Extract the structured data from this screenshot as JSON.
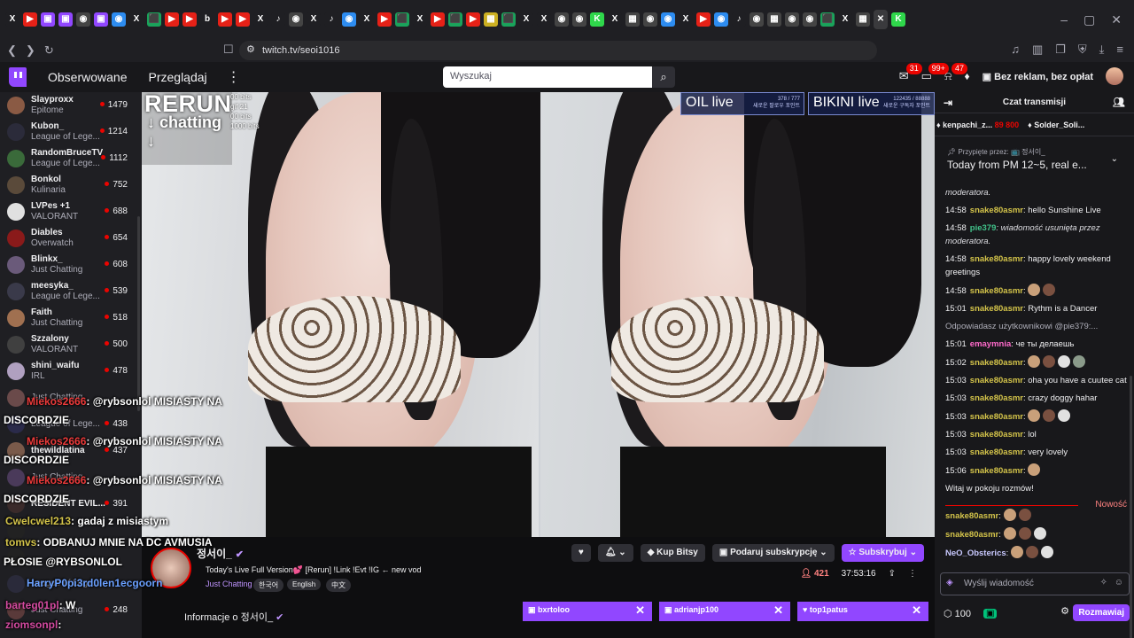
{
  "browser": {
    "url": "twitch.tv/seoi1016",
    "tab_favicons": [
      {
        "glyph": "X",
        "color": "#1f1f23"
      },
      {
        "glyph": "▶",
        "color": "#e62117"
      },
      {
        "glyph": "▣",
        "color": "#9147ff"
      },
      {
        "glyph": "▣",
        "color": "#9147ff"
      },
      {
        "glyph": "◉",
        "color": "#444"
      },
      {
        "glyph": "▣",
        "color": "#9147ff"
      },
      {
        "glyph": "◉",
        "color": "#2d8cf0"
      },
      {
        "glyph": "X",
        "color": "#1f1f23"
      },
      {
        "glyph": "⬛",
        "color": "#1aa35b"
      },
      {
        "glyph": "▶",
        "color": "#e62117"
      },
      {
        "glyph": "▶",
        "color": "#e62117"
      },
      {
        "glyph": "b",
        "color": "#1f1f23"
      },
      {
        "glyph": "▶",
        "color": "#e62117"
      },
      {
        "glyph": "▶",
        "color": "#e62117"
      },
      {
        "glyph": "X",
        "color": "#1f1f23"
      },
      {
        "glyph": "♪",
        "color": "#1f1f23"
      },
      {
        "glyph": "◉",
        "color": "#444"
      },
      {
        "glyph": "X",
        "color": "#1f1f23"
      },
      {
        "glyph": "♪",
        "color": "#1f1f23"
      },
      {
        "glyph": "◉",
        "color": "#2d8cf0"
      },
      {
        "glyph": "X",
        "color": "#1f1f23"
      },
      {
        "glyph": "▶",
        "color": "#e62117"
      },
      {
        "glyph": "⬛",
        "color": "#1aa35b"
      },
      {
        "glyph": "X",
        "color": "#1f1f23"
      },
      {
        "glyph": "▶",
        "color": "#e62117"
      },
      {
        "glyph": "⬛",
        "color": "#1aa35b"
      },
      {
        "glyph": "▶",
        "color": "#e62117"
      },
      {
        "glyph": "▦",
        "color": "#ccb022"
      },
      {
        "glyph": "⬛",
        "color": "#1aa35b"
      },
      {
        "glyph": "X",
        "color": "#1f1f23"
      },
      {
        "glyph": "X",
        "color": "#1f1f23"
      },
      {
        "glyph": "◉",
        "color": "#444"
      },
      {
        "glyph": "◉",
        "color": "#444"
      },
      {
        "glyph": "K",
        "color": "#2fd74b"
      },
      {
        "glyph": "X",
        "color": "#1f1f23"
      },
      {
        "glyph": "▦",
        "color": "#444"
      },
      {
        "glyph": "◉",
        "color": "#444"
      },
      {
        "glyph": "◉",
        "color": "#2d8cf0"
      },
      {
        "glyph": "X",
        "color": "#1f1f23"
      },
      {
        "glyph": "▶",
        "color": "#e62117"
      },
      {
        "glyph": "◉",
        "color": "#2d8cf0"
      },
      {
        "glyph": "♪",
        "color": "#1f1f23"
      },
      {
        "glyph": "◉",
        "color": "#444"
      },
      {
        "glyph": "▦",
        "color": "#444"
      },
      {
        "glyph": "◉",
        "color": "#444"
      },
      {
        "glyph": "◉",
        "color": "#444"
      },
      {
        "glyph": "⬛",
        "color": "#1aa35b"
      },
      {
        "glyph": "X",
        "color": "#1f1f23"
      },
      {
        "glyph": "▦",
        "color": "#444"
      },
      {
        "glyph": "✕",
        "color": "#3a3a3d"
      },
      {
        "glyph": "K",
        "color": "#2fd74b"
      }
    ]
  },
  "topnav": {
    "following": "Obserwowane",
    "browse": "Przeglądaj",
    "search_placeholder": "Wyszukaj",
    "badge_1": "31",
    "badge_2": "99+",
    "badge_3": "47",
    "no_ads": "Bez reklam, bez opłat"
  },
  "sidebar": {
    "channels": [
      {
        "name": "Slayproxx",
        "category": "Epitome",
        "viewers": "1479",
        "avatar": "#8a5a44"
      },
      {
        "name": "Kubon_",
        "category": "League of Lege...",
        "viewers": "1214",
        "avatar": "#2b2b3a"
      },
      {
        "name": "RandomBruceTV",
        "category": "League of Lege...",
        "viewers": "1112",
        "avatar": "#3a6a3a"
      },
      {
        "name": "Bonkol",
        "category": "Kulinaria",
        "viewers": "752",
        "avatar": "#5a4a3a"
      },
      {
        "name": "LVPes +1",
        "category": "VALORANT",
        "viewers": "688",
        "avatar": "#e0e0e0"
      },
      {
        "name": "Diables",
        "category": "Overwatch",
        "viewers": "654",
        "avatar": "#8a1a1a"
      },
      {
        "name": "Blinkx_",
        "category": "Just Chatting",
        "viewers": "608",
        "avatar": "#6a5a7a"
      },
      {
        "name": "meesyka_",
        "category": "League of Lege...",
        "viewers": "539",
        "avatar": "#3a3a4a"
      },
      {
        "name": "Faith",
        "category": "Just Chatting",
        "viewers": "518",
        "avatar": "#a07050"
      },
      {
        "name": "Szzalony",
        "category": "VALORANT",
        "viewers": "500",
        "avatar": "#404040"
      },
      {
        "name": "shini_waifu",
        "category": "IRL",
        "viewers": "478",
        "avatar": "#b0a0c0"
      },
      {
        "name": "",
        "category": "Just Chatting",
        "viewers": "",
        "avatar": "#6a4a4a"
      },
      {
        "name": "",
        "category": "League of Lege...",
        "viewers": "438",
        "avatar": "#2a2a4a"
      },
      {
        "name": "thewildlatina",
        "category": "",
        "viewers": "437",
        "avatar": "#7a5a4a"
      },
      {
        "name": "",
        "category": "Just Chatting",
        "viewers": "",
        "avatar": "#4a3a5a"
      },
      {
        "name": "RESIDENT EVIL...",
        "category": "",
        "viewers": "391",
        "avatar": "#3a2a2a"
      },
      {
        "name": "",
        "category": "",
        "viewers": "",
        "avatar": "#222"
      },
      {
        "name": "",
        "category": "",
        "viewers": "",
        "avatar": "#222"
      },
      {
        "name": "",
        "category": "League of Lege...",
        "viewers": "",
        "avatar": "#2a2a3a"
      },
      {
        "name": "",
        "category": "Just Chatting",
        "viewers": "248",
        "avatar": "#5a3a3a"
      }
    ]
  },
  "video": {
    "rerun": "RERUN",
    "chatting": "↓ chatting ↓",
    "bits_lines": [
      "00 bits",
      "gif 21",
      "",
      "00 bits",
      "1000 bits"
    ],
    "oil_label": "OIL live",
    "oil_meta": [
      "378 / 777",
      "새로운 팔로우 포인트"
    ],
    "bikini_label": "BIKINI live",
    "bikini_meta": [
      "122435 / 88888",
      "새로운 구독자 포인트"
    ]
  },
  "overlay_chat": [
    {
      "user": "Miekos2666",
      "text": ": @rybsonlol MISIASTY NA",
      "user_color": "#eb3a3a"
    },
    {
      "user": "",
      "text": "DISCORDZIE",
      "user_color": "#ffffff"
    },
    {
      "user": "Miekos2666",
      "text": ": @rybsonlol MISIASTY NA",
      "user_color": "#eb3a3a"
    },
    {
      "user": "",
      "text": "DISCORDZIE",
      "user_color": "#ffffff"
    },
    {
      "user": "Miekos2666",
      "text": ": @rybsonlol MISIASTY NA",
      "user_color": "#eb3a3a"
    },
    {
      "user": "",
      "text": "DISCORDZIE",
      "user_color": "#ffffff"
    },
    {
      "user": "Cwelcwel213",
      "text": ": gadaj z misiastym",
      "user_color": "#d4c44a"
    },
    {
      "user": "tomvs",
      "text": ": ODBANUJ MNIE NA DC AVMUSIA",
      "user_color": "#d4c44a"
    },
    {
      "user": "",
      "text": "PŁOSIE @RYBSONLOL",
      "user_color": "#ffffff"
    },
    {
      "user": "HarryP0pi3rd0len1ecgoorn",
      "text": "",
      "user_color": "#6aa0ff"
    },
    {
      "user": "barteg01pl",
      "text": ": W",
      "user_color": "#d44aa0"
    },
    {
      "user": "ziomsonpl",
      "text": ": ",
      "user_color": "#d44aa0"
    }
  ],
  "stream": {
    "streamer": "정서이_",
    "title": "Today's Live Full Version💕 [Rerun] !Link !Evt !IG ← new vod",
    "category": "Just Chatting",
    "tags": [
      "한국어",
      "English",
      "中文"
    ],
    "follow_icon": "heart-icon",
    "bits_button": "Kup Bitsy",
    "gift_button": "Podaruj subskrypcję",
    "subscribe_button": "Subskrybuj",
    "viewers": "421",
    "uptime": "37:53:16",
    "about": "Informacje o 정서이_",
    "accent": "#9147ff"
  },
  "popup_tabs": [
    "bxrtoloo",
    "adrianjp100",
    "top1patus"
  ],
  "chat": {
    "header": "Czat transmisji",
    "gifters": [
      {
        "name": "kenpachi_z...",
        "amount": "89 800"
      },
      {
        "name": "Solder_Soli...",
        "amount": ""
      }
    ],
    "pinned_by": "Przypięte przez: 📺 정서이_",
    "pinned_text": "Today from PM 12~5, real e...",
    "messages": [
      {
        "time": "",
        "user": "",
        "user_color": "#efeff1",
        "text": "moderatora.",
        "deleted": true
      },
      {
        "time": "14:58",
        "user": "snake80asmr",
        "user_color": "#d4c44a",
        "text": ": hello Sunshine Live",
        "deleted": false
      },
      {
        "time": "14:58",
        "user": "pie379",
        "user_color": "#41c28a",
        "text": ": wiadomość usunięta przez moderatora.",
        "deleted": true
      },
      {
        "time": "14:58",
        "user": "snake80asmr",
        "user_color": "#d4c44a",
        "text": ": happy lovely weekend greetings",
        "deleted": false
      },
      {
        "time": "14:58",
        "user": "snake80asmr",
        "user_color": "#d4c44a",
        "text": ":",
        "deleted": false,
        "emotes": 2
      },
      {
        "time": "15:01",
        "user": "snake80asmr",
        "user_color": "#d4c44a",
        "text": ": Rythm is a Dancer",
        "deleted": false
      },
      {
        "time": "",
        "user": "",
        "user_color": "#adadb8",
        "text": "Odpowiadasz użytkownikowi @pie379:...",
        "deleted": false,
        "reply": true
      },
      {
        "time": "15:01",
        "user": "emaymnia",
        "user_color": "#ff6acb",
        "text": ": че ты делаешь",
        "deleted": false
      },
      {
        "time": "15:02",
        "user": "snake80asmr",
        "user_color": "#d4c44a",
        "text": ":",
        "deleted": false,
        "emotes": 4
      },
      {
        "time": "15:03",
        "user": "snake80asmr",
        "user_color": "#d4c44a",
        "text": ": oha you have a cuutee cat",
        "deleted": false
      },
      {
        "time": "15:03",
        "user": "snake80asmr",
        "user_color": "#d4c44a",
        "text": ": crazy doggy hahar",
        "deleted": false
      },
      {
        "time": "15:03",
        "user": "snake80asmr",
        "user_color": "#d4c44a",
        "text": ":",
        "deleted": false,
        "emotes": 3
      },
      {
        "time": "15:03",
        "user": "snake80asmr",
        "user_color": "#d4c44a",
        "text": ": lol",
        "deleted": false
      },
      {
        "time": "15:03",
        "user": "snake80asmr",
        "user_color": "#d4c44a",
        "text": ": very lovely",
        "deleted": false
      },
      {
        "time": "15:06",
        "user": "snake80asmr",
        "user_color": "#d4c44a",
        "text": ":",
        "deleted": false,
        "emotes": 1
      },
      {
        "time": "",
        "user": "",
        "user_color": "#efeff1",
        "text": "Witaj w pokoju rozmów!",
        "deleted": false
      }
    ],
    "new_label": "Nowość",
    "new_messages": [
      {
        "user": "snake80asmr",
        "user_color": "#d4c44a",
        "text": ":",
        "emotes": 2
      },
      {
        "user": "snake80asmr",
        "user_color": "#d4c44a",
        "text": ":",
        "emotes": 3
      },
      {
        "user": "NeO_Obsterics",
        "user_color": "#c9c9ff",
        "text": ":",
        "emotes": 3
      }
    ],
    "input_placeholder": "Wyślij wiadomość",
    "points": "100",
    "send_button": "Rozmawiaj"
  }
}
